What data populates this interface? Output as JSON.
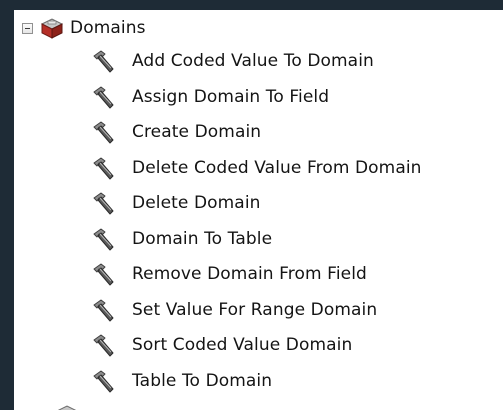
{
  "tree": {
    "root": {
      "label": "Domains",
      "icon": "toolbox-icon",
      "expander_icon": "collapse-minus-icon"
    },
    "tools": [
      {
        "label": "Add Coded Value To Domain",
        "icon": "hammer-icon"
      },
      {
        "label": "Assign Domain To Field",
        "icon": "hammer-icon"
      },
      {
        "label": "Create Domain",
        "icon": "hammer-icon"
      },
      {
        "label": "Delete Coded Value From Domain",
        "icon": "hammer-icon"
      },
      {
        "label": "Delete Domain",
        "icon": "hammer-icon"
      },
      {
        "label": "Domain To Table",
        "icon": "hammer-icon"
      },
      {
        "label": "Remove Domain From Field",
        "icon": "hammer-icon"
      },
      {
        "label": "Set Value For Range Domain",
        "icon": "hammer-icon"
      },
      {
        "label": "Sort Coded Value Domain",
        "icon": "hammer-icon"
      },
      {
        "label": "Table To Domain",
        "icon": "hammer-icon"
      }
    ]
  },
  "colors": {
    "frame_background": "#1e2b36",
    "panel_background": "#ffffff",
    "text": "#141414"
  }
}
